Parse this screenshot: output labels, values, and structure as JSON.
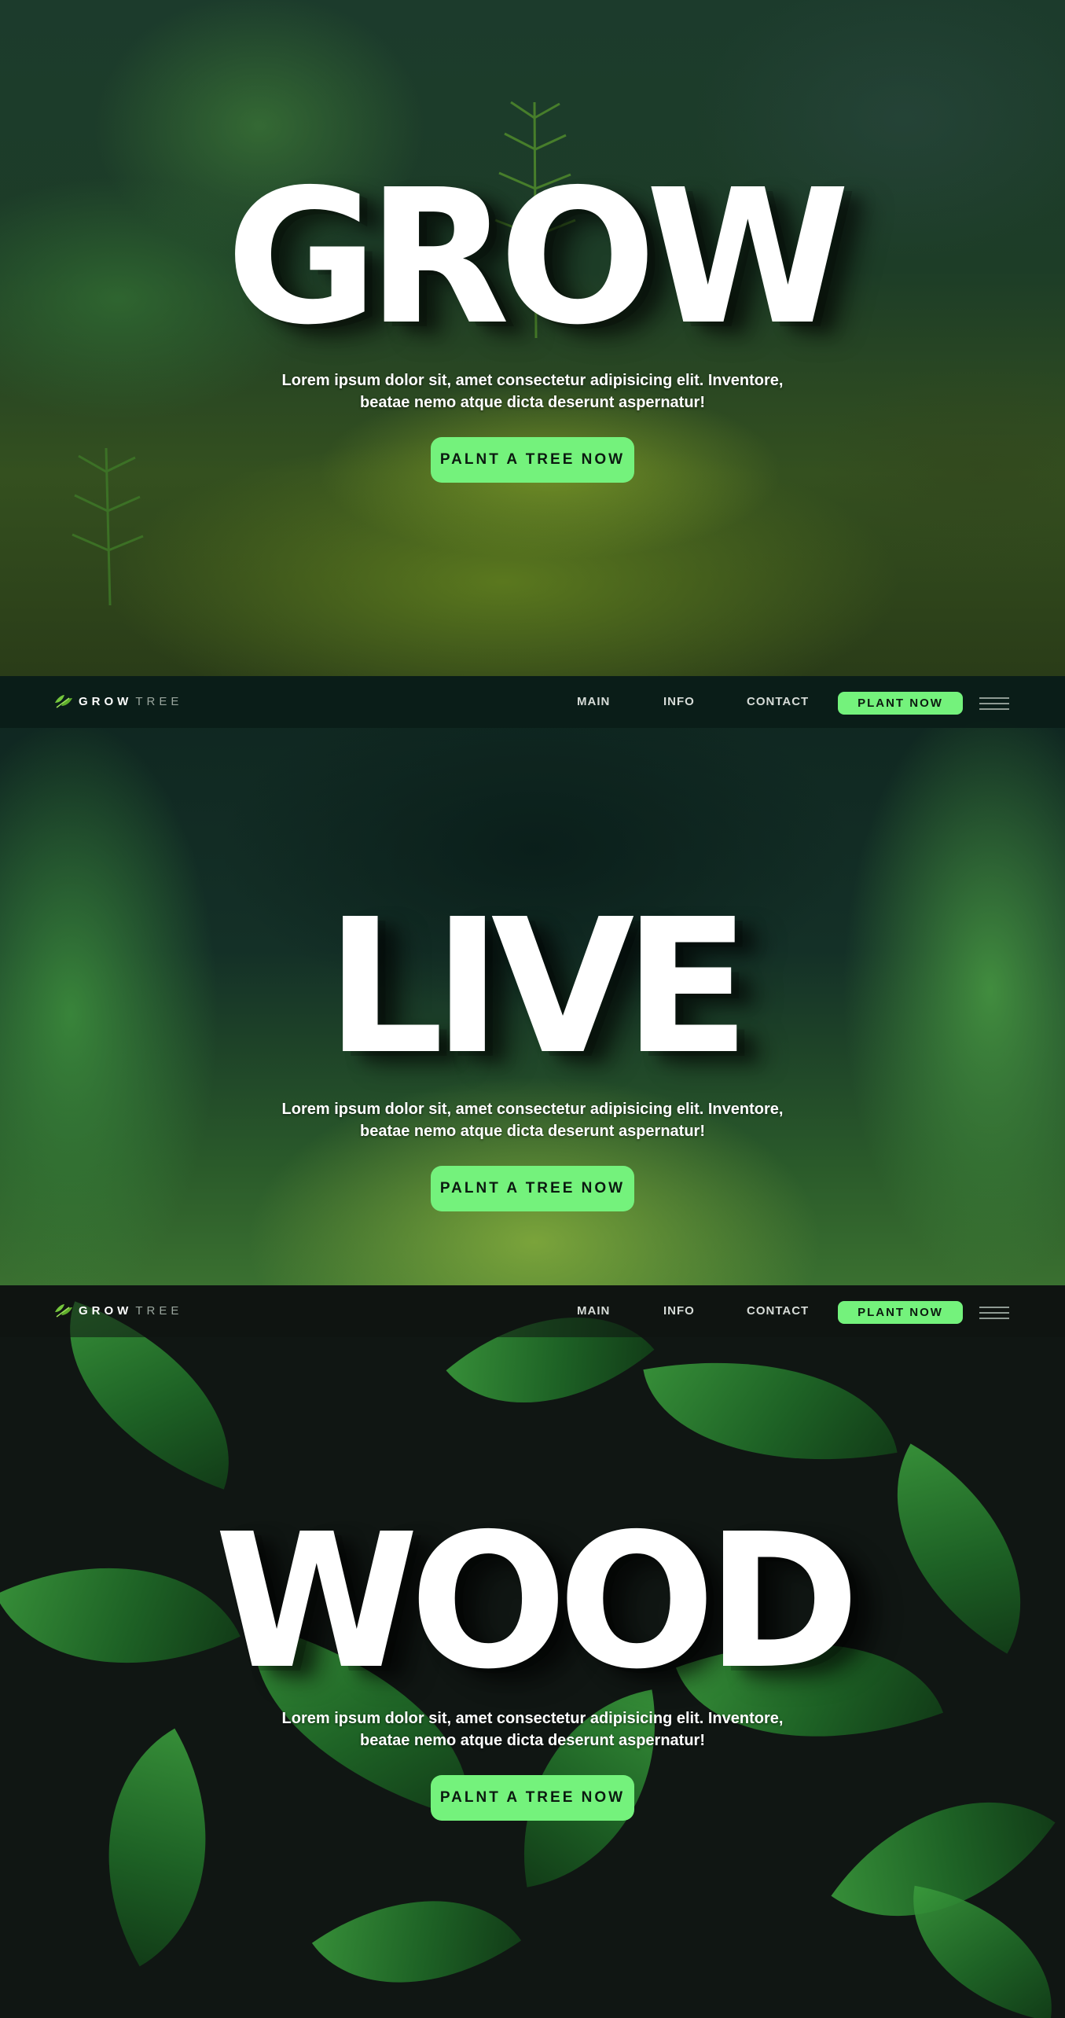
{
  "brand": {
    "logo_grow": "GROW",
    "logo_tree": "TREE"
  },
  "nav": {
    "main": "MAIN",
    "info": "INFO",
    "contact": "CONTACT",
    "cta": "PLANT NOW"
  },
  "slides": [
    {
      "title": "GROW",
      "text_line1": "Lorem ipsum dolor sit, amet consectetur adipisicing elit. Inventore,",
      "text_line2": "beatae nemo atque dicta deserunt aspernatur!",
      "cta": "PALNT A TREE NOW"
    },
    {
      "title": "LIVE",
      "text_line1": "Lorem ipsum dolor sit, amet consectetur adipisicing elit. Inventore,",
      "text_line2": "beatae nemo atque dicta deserunt aspernatur!",
      "cta": "PALNT A TREE NOW"
    },
    {
      "title": "WOOD",
      "text_line1": "Lorem ipsum dolor sit, amet consectetur adipisicing elit. Inventore,",
      "text_line2": "beatae nemo atque dicta deserunt aspernatur!",
      "cta": "PALNT A TREE NOW"
    }
  ],
  "colors": {
    "accent": "#74f27c",
    "text": "#ffffff",
    "nav_text": "#d7dcd8",
    "header_dark": "#0a1c18"
  },
  "icons": {
    "logo": "leaf-logo-icon",
    "menu": "hamburger-menu-icon"
  }
}
